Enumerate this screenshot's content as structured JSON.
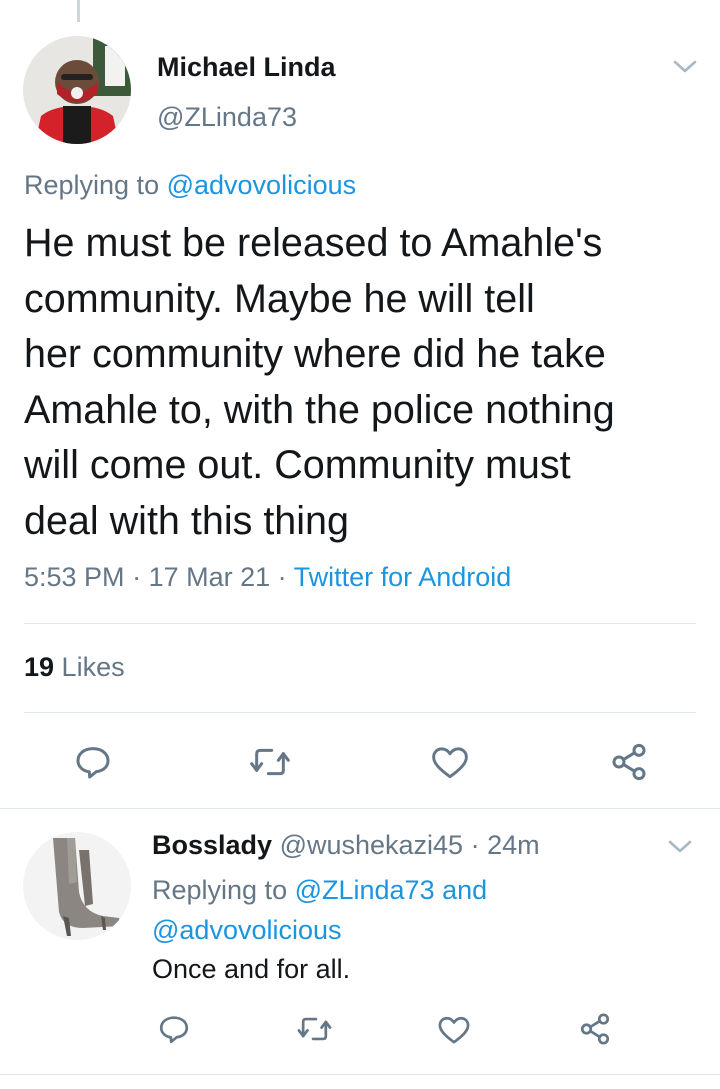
{
  "tweet": {
    "author_name": "Michael Linda",
    "author_handle": "@ZLinda73",
    "replying_prefix": "Replying to ",
    "replying_to": "@advovolicious",
    "text": "He must be released to Amahle's\ncommunity. Maybe he will tell\nher community where did he take\nAmahle to, with the police nothing\nwill come out. Community must\ndeal with this thing",
    "time": "5:53 PM",
    "sep1": " · ",
    "date": "17 Mar 21",
    "sep2": " · ",
    "client": "Twitter for Android",
    "likes_count": "19",
    "likes_label": " Likes"
  },
  "reply": {
    "author_name": "Bosslady",
    "author_handle": " @wushekazi45",
    "time_ago": " · 24m",
    "replying_prefix": "Replying to ",
    "replying_to_1": "@ZLinda73",
    "and_text": " and",
    "replying_to_2": "@advovolicious",
    "text": "Once and for all."
  },
  "icons": {
    "reply": "reply-icon",
    "retweet": "retweet-icon",
    "like": "heart-icon",
    "share": "share-icon",
    "more": "chevron-down-icon"
  },
  "colors": {
    "link": "#1b95e0",
    "secondary_text": "#657786",
    "divider": "#e1e8ed"
  }
}
